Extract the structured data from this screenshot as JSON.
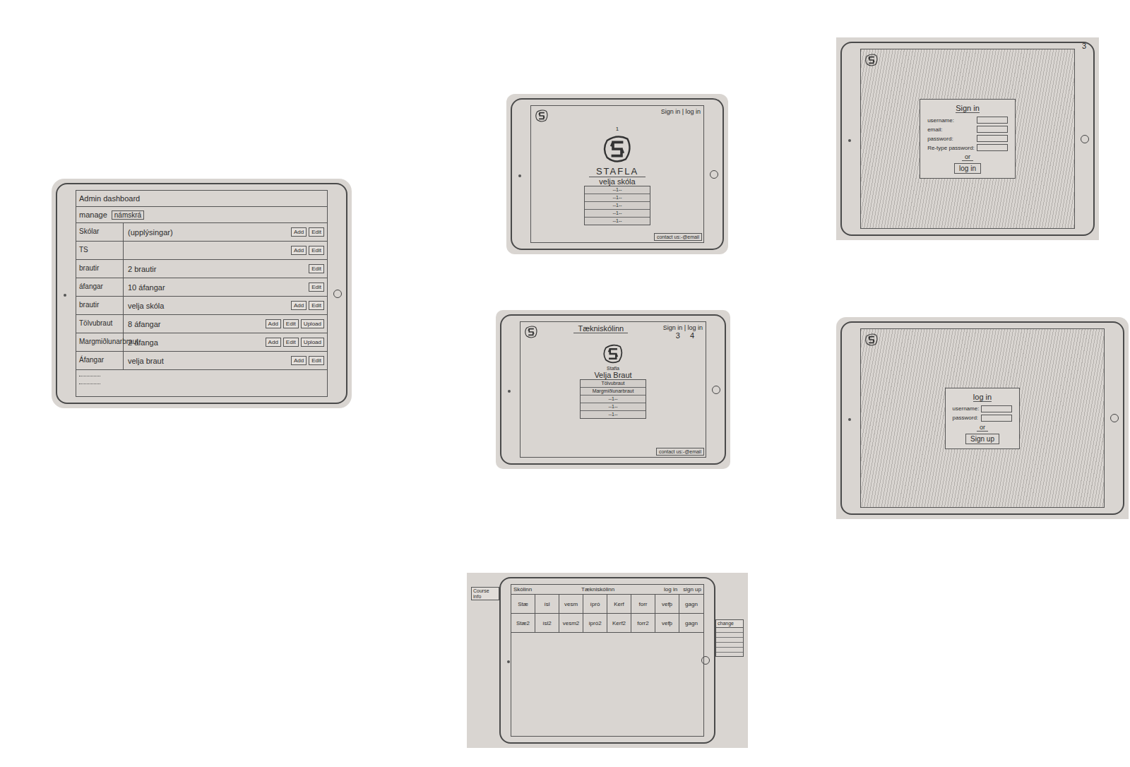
{
  "sketches": [
    {
      "kind": "admin",
      "title": "Admin dashboard",
      "manage": {
        "label": "manage",
        "value": "námskrá"
      },
      "rows": [
        {
          "label": "Skólar",
          "value": "(upplýsingar)",
          "buttons": [
            "Add",
            "Edit"
          ]
        },
        {
          "label": "TS",
          "value": "",
          "buttons": [
            "Add",
            "Edit"
          ]
        },
        {
          "label": "brautir",
          "value": "2 brautir",
          "buttons": [
            "Edit"
          ]
        },
        {
          "label": "áfangar",
          "value": "10 áfangar",
          "buttons": [
            "Edit"
          ]
        },
        {
          "label": "brautir",
          "value": "velja skóla",
          "buttons": [
            "Add",
            "Edit"
          ]
        },
        {
          "label": "Tölvubraut",
          "value": "8 áfangar",
          "buttons": [
            "Add",
            "Edit",
            "Upload"
          ]
        },
        {
          "label": "Margmiðlunarbraut",
          "value": "2 áfanga",
          "buttons": [
            "Add",
            "Edit",
            "Upload"
          ]
        },
        {
          "label": "Áfangar",
          "value": "velja braut",
          "buttons": [
            "Add",
            "Edit"
          ]
        }
      ]
    },
    {
      "kind": "home",
      "page": "1",
      "auth": "Sign in | log in",
      "brand": "STAFLA",
      "prompt": "velja skóla",
      "list": [
        "--1--",
        "--1--",
        "--1--",
        "--1--",
        "--1--"
      ],
      "footer": "contact us:-@email"
    },
    {
      "kind": "form",
      "page": "3",
      "title": "Sign in",
      "fields": [
        "username:",
        "email:",
        "password:",
        "Re-type password:"
      ],
      "or": "or",
      "button": "log in"
    },
    {
      "kind": "home",
      "title": "Tækniskólinn",
      "auth": "Sign in | log in",
      "pages": [
        "3",
        "4"
      ],
      "brand": "Stafla",
      "prompt": "Velja Braut",
      "list": [
        "Tölvubraut",
        "Margmiðlunarbraut",
        "--1--",
        "--1--",
        "--1--"
      ],
      "footer": "contact us:-@email"
    },
    {
      "kind": "form",
      "title": "log in",
      "fields": [
        "username:",
        "password:"
      ],
      "or": "or",
      "button": "Sign up"
    },
    {
      "kind": "grid",
      "left_note": "Course info",
      "brand": "Skólinn",
      "title": "Tækniskólinn",
      "links": [
        "log in",
        "sign up"
      ],
      "rows": [
        [
          "Stæ",
          "ísl",
          "vesm",
          "ípró",
          "Kerf",
          "forr",
          "vefþ",
          "gagn"
        ],
        [
          "Stæ2",
          "ísl2",
          "vesm2",
          "ípró2",
          "Kerf2",
          "forr2",
          "vefþ",
          "gagn"
        ]
      ],
      "right_note": "change"
    }
  ]
}
